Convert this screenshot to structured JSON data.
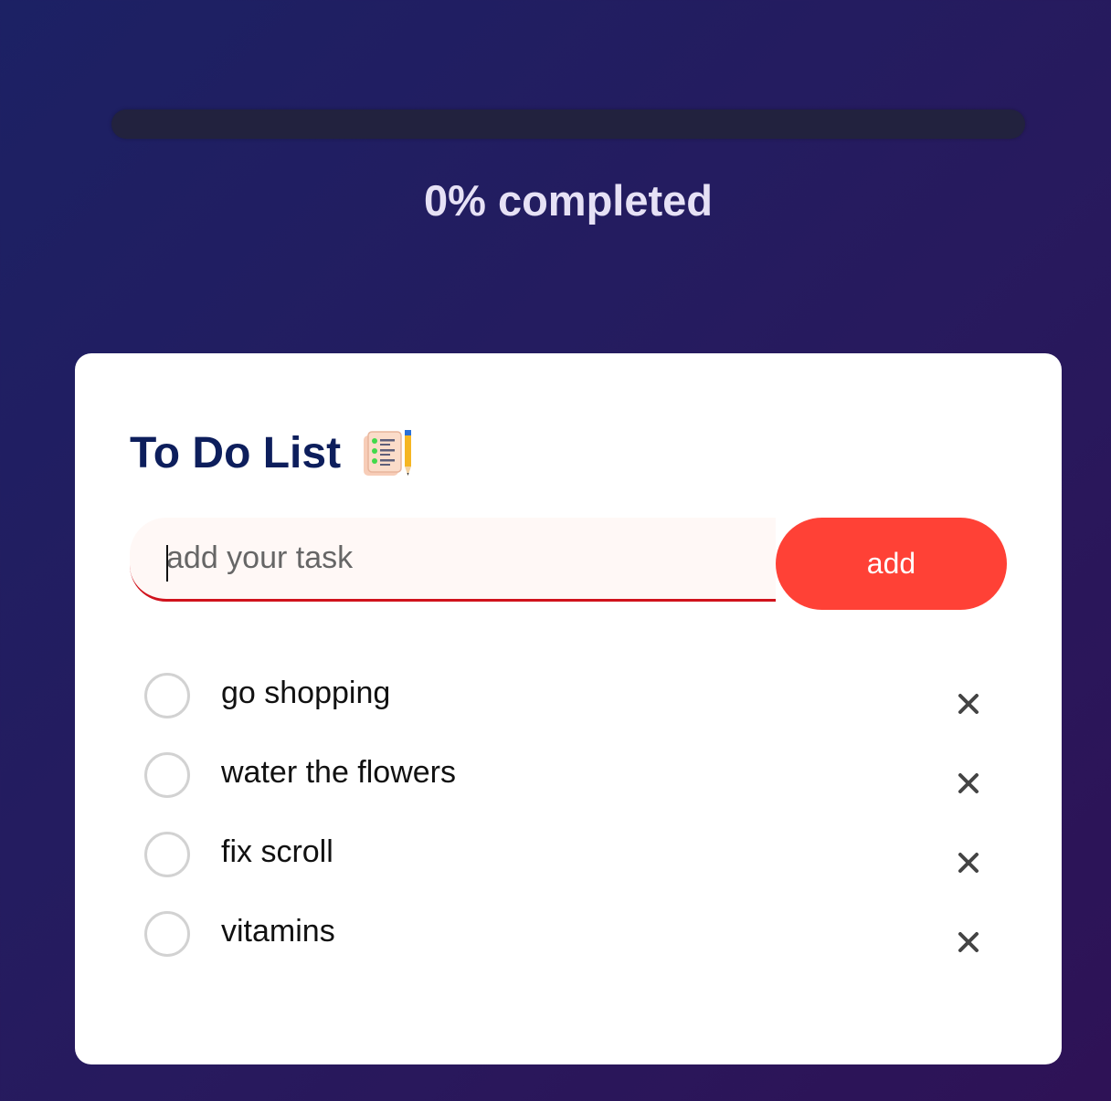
{
  "progress": {
    "completed_fraction": 0,
    "label": "0% completed",
    "fill_color": "#ff4136"
  },
  "todo": {
    "title": "To Do List",
    "title_icon": "notepad-with-pencil-icon",
    "input": {
      "value": "",
      "placeholder": "add your task"
    },
    "add_label": "add",
    "accent_color": "#ff4136",
    "tasks": [
      {
        "text": "go shopping",
        "done": false
      },
      {
        "text": "water the flowers",
        "done": false
      },
      {
        "text": "fix scroll",
        "done": false
      },
      {
        "text": "vitamins",
        "done": false
      }
    ],
    "delete_icon": "close-icon"
  }
}
